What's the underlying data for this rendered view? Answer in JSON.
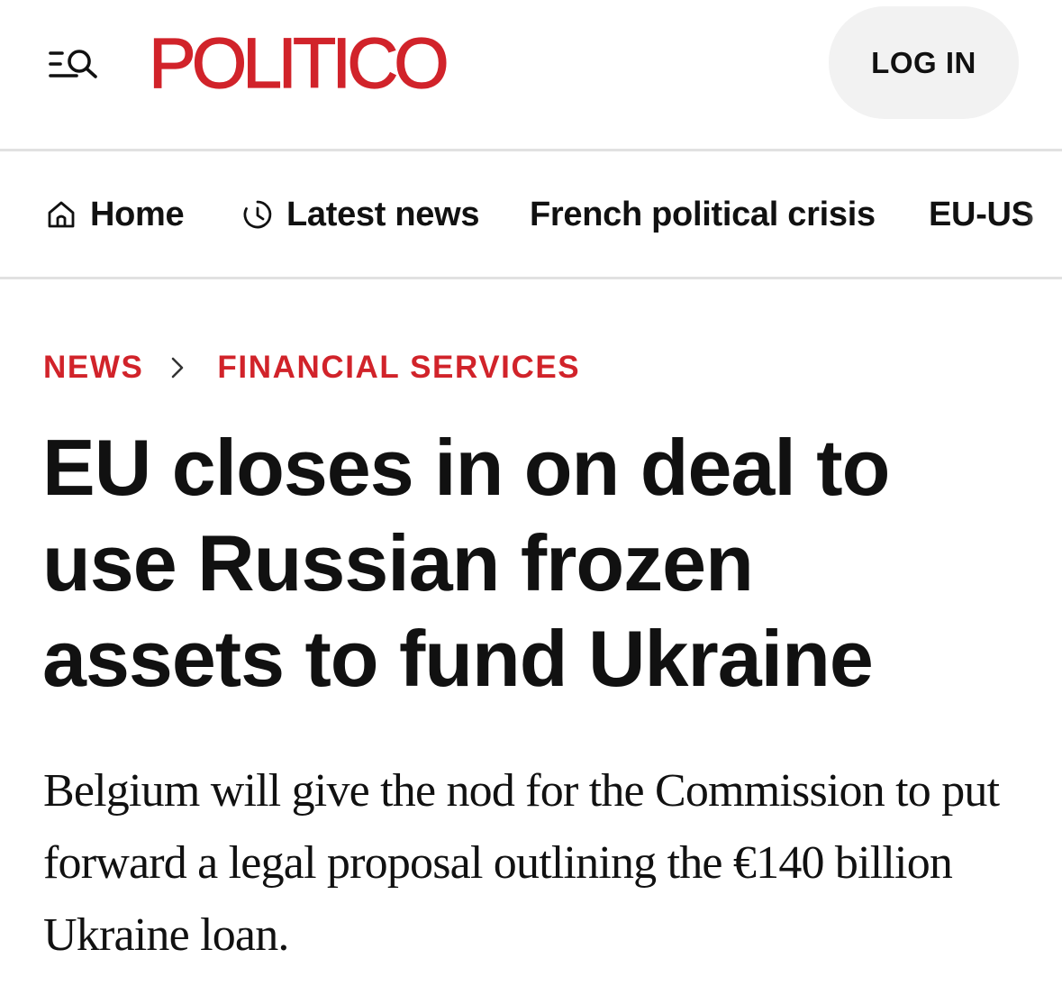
{
  "header": {
    "menu_icon": "menu-search-icon",
    "logo_text": "POLITICO",
    "login_label": "LOG IN",
    "brand_color": "#d1232a"
  },
  "nav": {
    "items": [
      {
        "label": "Home",
        "icon": "home-icon"
      },
      {
        "label": "Latest news",
        "icon": "clock-icon"
      },
      {
        "label": "French political crisis"
      },
      {
        "label": "EU-US"
      }
    ]
  },
  "breadcrumb": {
    "items": [
      "NEWS",
      "FINANCIAL SERVICES"
    ],
    "separator_icon": "chevron-right-icon"
  },
  "article": {
    "headline": "EU closes in on deal to use Russian frozen assets to fund Ukraine",
    "dek": "Belgium will give the nod for the Commission to put forward a legal proposal outlining the €140 billion Ukraine loan."
  }
}
